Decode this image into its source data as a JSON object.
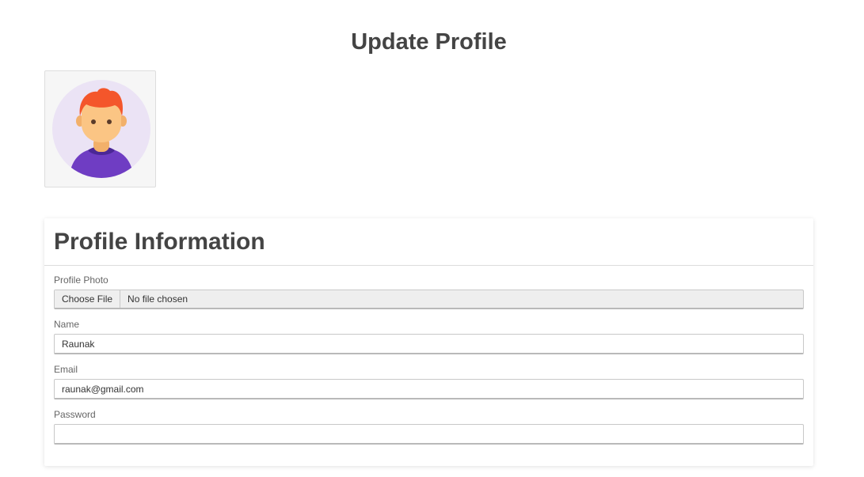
{
  "header": {
    "title": "Update Profile"
  },
  "avatar": {
    "icon": "user-avatar-icon",
    "colors": {
      "background": "#ebe3f5",
      "hair": "#f4562b",
      "skin": "#fbc584",
      "shirt": "#6f3dc3",
      "collar": "#4b2796"
    }
  },
  "card": {
    "title": "Profile Information",
    "fields": {
      "photo": {
        "label": "Profile Photo",
        "button_label": "Choose File",
        "status": "No file chosen"
      },
      "name": {
        "label": "Name",
        "value": "Raunak"
      },
      "email": {
        "label": "Email",
        "value": "raunak@gmail.com"
      },
      "password": {
        "label": "Password",
        "value": ""
      }
    }
  }
}
